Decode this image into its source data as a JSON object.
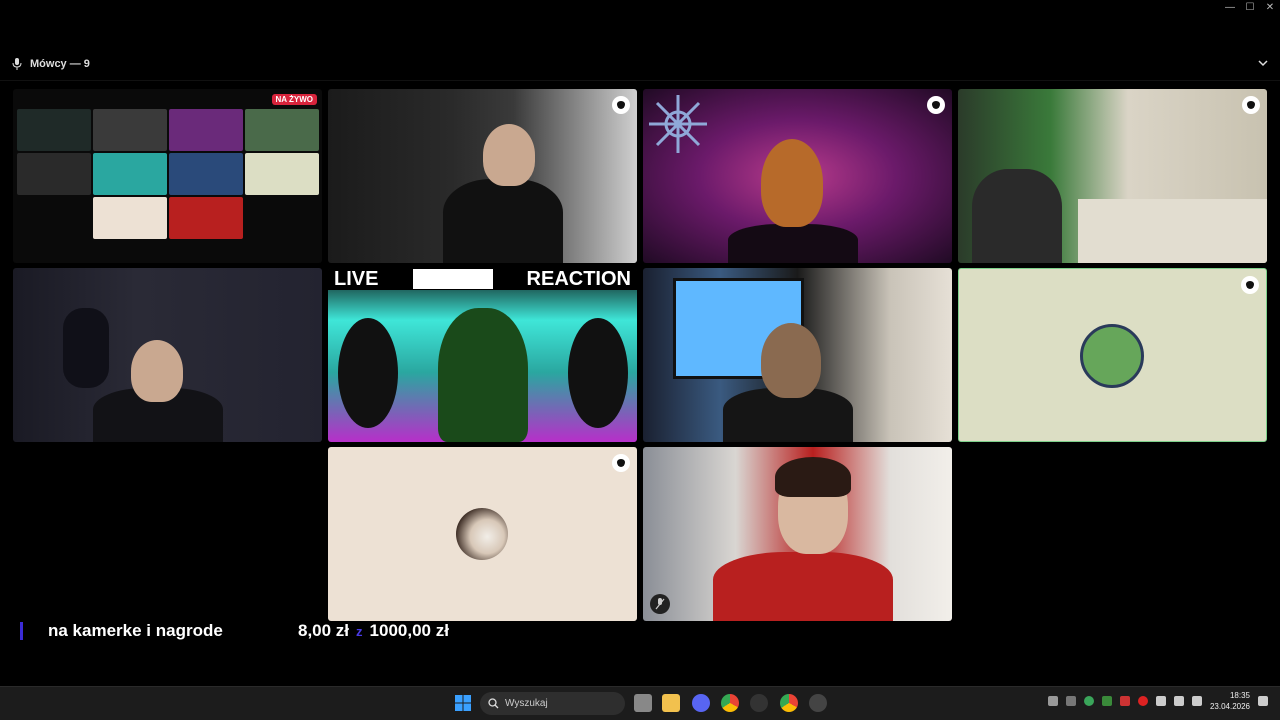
{
  "window": {
    "minimize": "—",
    "maximize": "☐",
    "close": "✕"
  },
  "header": {
    "speakers_label": "Mówcy — 9"
  },
  "tiles": {
    "t1_live_badge": "NA ŻYWO",
    "t6_live": "LIVE",
    "t6_reaction": "REACTION"
  },
  "donation": {
    "label": "na kamerke i nagrode",
    "current": "8,00 zł",
    "separator": "z",
    "goal": "1000,00 zł"
  },
  "taskbar": {
    "search_placeholder": "Wyszukaj",
    "time": "18:35",
    "date": "23.04.2026"
  },
  "colors": {
    "live_badge": "#d8243c",
    "donation_accent": "#3b2bd6",
    "active_border": "#7ed18b"
  }
}
